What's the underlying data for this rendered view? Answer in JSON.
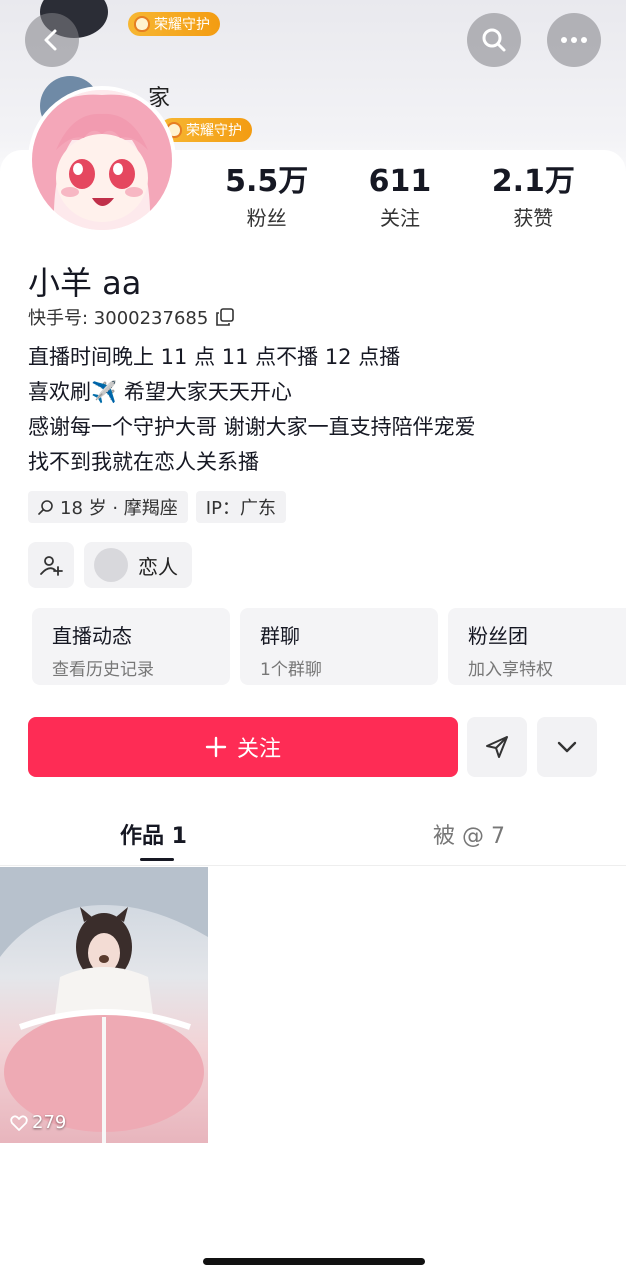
{
  "header": {
    "honor_badge_top": "荣耀守护",
    "honor_badge_mid": "荣耀守护",
    "ghost_name": "家",
    "icons": {
      "back": "back-arrow-icon",
      "search": "search-icon",
      "more": "more-icon"
    }
  },
  "profile": {
    "nickname": "小羊 aa",
    "kuaishou_id": "快手号: 3000237685",
    "stats": [
      {
        "value": "5.5万",
        "label": "粉丝"
      },
      {
        "value": "611",
        "label": "关注"
      },
      {
        "value": "2.1万",
        "label": "获赞"
      }
    ],
    "bio": [
      "直播时间晚上 11 点 11 点不播 12 点播",
      "喜欢刷✈️ 希望大家天天开心",
      "感谢每一个守护大哥 谢谢大家一直支持陪伴宠爱",
      "找不到我就在恋人关系播"
    ],
    "tags": [
      "18 岁 · 摩羯座",
      "IP：广东"
    ],
    "relation_label": "恋人"
  },
  "cards": [
    {
      "title": "直播动态",
      "sub": "查看历史记录"
    },
    {
      "title": "群聊",
      "sub": "1个群聊"
    },
    {
      "title": "粉丝团",
      "sub": "加入享特权"
    }
  ],
  "actions": {
    "follow_label": "关注"
  },
  "tabs": {
    "works": "作品 1",
    "mentioned": "被 @ 7"
  },
  "video": {
    "likes": "279"
  },
  "colors": {
    "accent": "#fe2c55",
    "honor": "#f39c12"
  }
}
